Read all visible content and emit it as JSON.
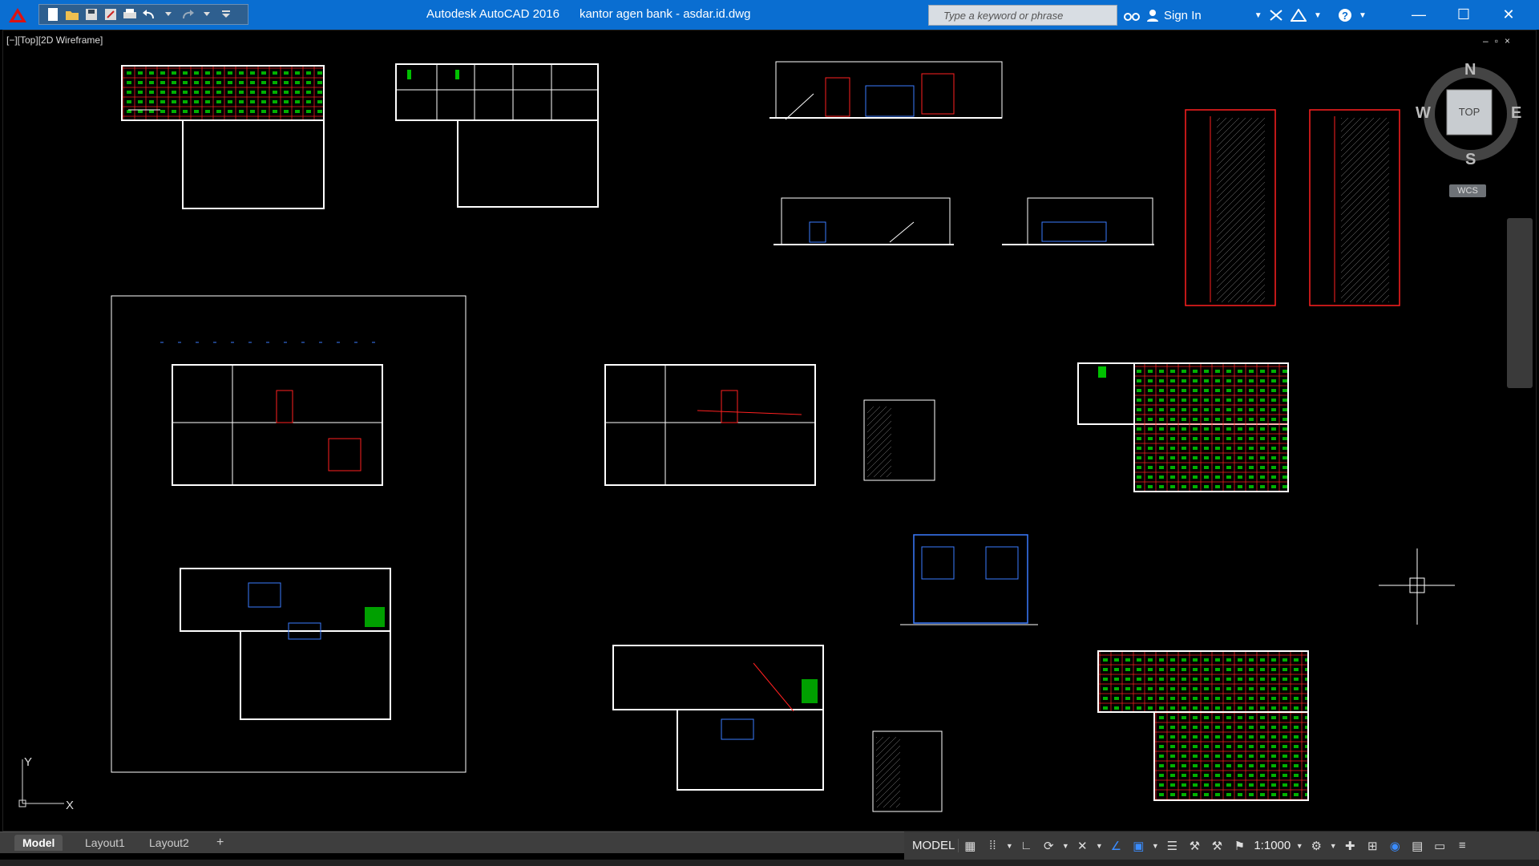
{
  "window": {
    "title": "Autodesk AutoCAD 2016      kantor agen bank - asdar.id.dwg",
    "search_placeholder": "Type a keyword or phrase",
    "sign_in": "Sign In"
  },
  "viewport": {
    "label": "[−][Top][2D Wireframe]",
    "controls": [
      "–",
      "▫",
      "×"
    ]
  },
  "viewcube": {
    "face": "TOP",
    "north": "N",
    "south": "S",
    "east": "E",
    "west": "W",
    "ucs": "WCS"
  },
  "ucs_axes": {
    "x": "X",
    "y": "Y"
  },
  "tabs": [
    {
      "label": "Model",
      "active": true
    },
    {
      "label": "Layout1",
      "active": false
    },
    {
      "label": "Layout2",
      "active": false
    }
  ],
  "tab_add": "+",
  "status": {
    "model": "MODEL",
    "scale": "1:1000"
  },
  "colors": {
    "titlebar": "#0a6ed1",
    "wall": "#ffffff",
    "red": "#ff2020",
    "green": "#00c000",
    "blue": "#3a7bff"
  }
}
